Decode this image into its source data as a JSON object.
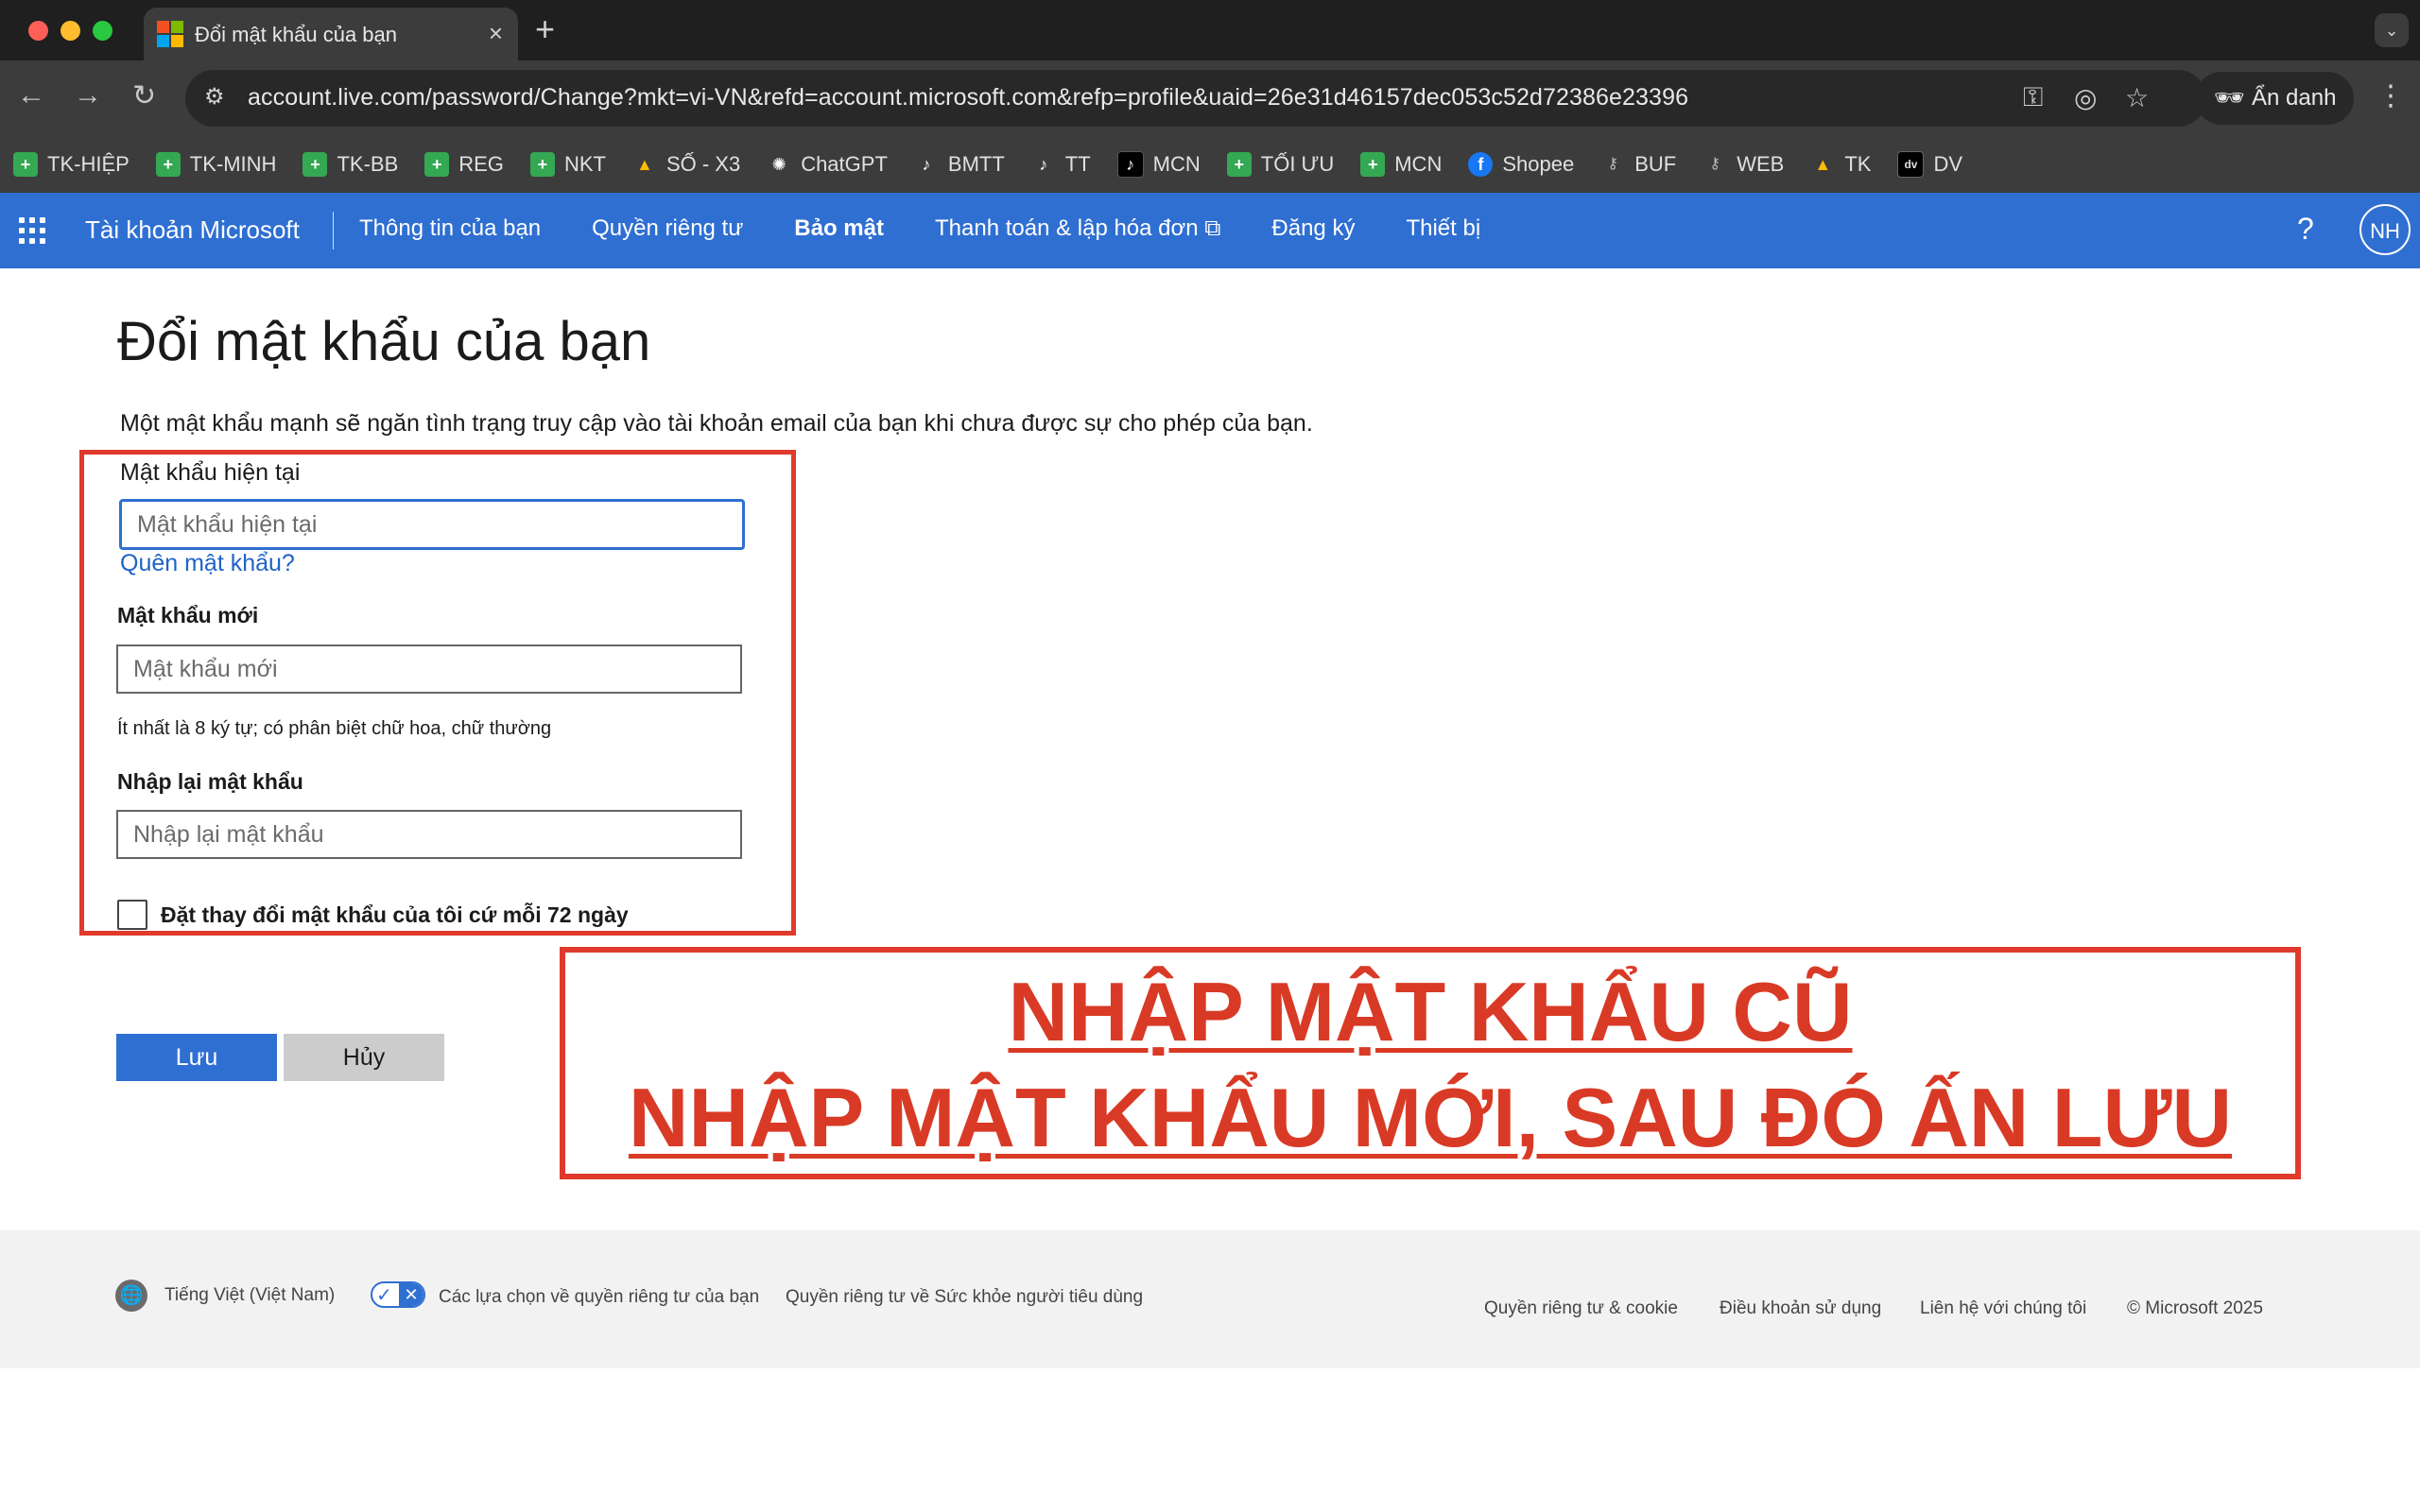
{
  "browser": {
    "tab_title": "Đổi mật khẩu của bạn",
    "tab_close": "×",
    "new_tab": "+",
    "url": "account.live.com/password/Change?mkt=vi-VN&refd=account.microsoft.com&refp=profile&uaid=26e31d46157dec053c52d72386e23396",
    "incognito_label": "Ẩn danh",
    "bookmarks": [
      {
        "label": "TK-HIỆP",
        "icon": "sheets-icon"
      },
      {
        "label": "TK-MINH",
        "icon": "sheets-icon"
      },
      {
        "label": "TK-BB",
        "icon": "sheets-icon"
      },
      {
        "label": "REG",
        "icon": "sheets-icon"
      },
      {
        "label": "NKT",
        "icon": "sheets-icon"
      },
      {
        "label": "SỐ - X3",
        "icon": "drive-icon"
      },
      {
        "label": "ChatGPT",
        "icon": "chatgpt-icon"
      },
      {
        "label": "BMTT",
        "icon": "tiktok-icon"
      },
      {
        "label": "TT",
        "icon": "tiktok-icon"
      },
      {
        "label": "MCN",
        "icon": "tiktok-box-icon"
      },
      {
        "label": "TỐI ƯU",
        "icon": "sheets-icon"
      },
      {
        "label": "MCN",
        "icon": "sheets-icon"
      },
      {
        "label": "Shopee",
        "icon": "facebook-icon"
      },
      {
        "label": "BUF",
        "icon": "key-icon"
      },
      {
        "label": "WEB",
        "icon": "key-icon"
      },
      {
        "label": "TK",
        "icon": "drive-icon"
      },
      {
        "label": "DV",
        "icon": "dv-icon"
      }
    ]
  },
  "ms_header": {
    "brand": "Tài khoản Microsoft",
    "nav": [
      {
        "label": "Thông tin của bạn",
        "active": false
      },
      {
        "label": "Quyền riêng tư",
        "active": false
      },
      {
        "label": "Bảo mật",
        "active": true
      },
      {
        "label": "Thanh toán & lập hóa đơn ⧉",
        "active": false
      },
      {
        "label": "Đăng ký",
        "active": false
      },
      {
        "label": "Thiết bị",
        "active": false
      }
    ],
    "help": "?",
    "avatar_initials": "NH"
  },
  "main": {
    "title": "Đổi mật khẩu của bạn",
    "intro": "Một mật khẩu mạnh sẽ ngăn tình trạng truy cập vào tài khoản email của bạn khi chưa được sự cho phép của bạn.",
    "current_label": "Mật khẩu hiện tại",
    "current_placeholder": "Mật khẩu hiện tại",
    "forgot_link": "Quên mật khẩu?",
    "new_label": "Mật khẩu mới",
    "new_placeholder": "Mật khẩu mới",
    "new_hint": "Ít nhất là 8 ký tự; có phân biệt chữ hoa, chữ thường",
    "confirm_label": "Nhập lại mật khẩu",
    "confirm_placeholder": "Nhập lại mật khẩu",
    "expire_checkbox_label": "Đặt thay đổi mật khẩu của tôi cứ mỗi 72 ngày",
    "expire_checked": false,
    "save_button": "Lưu",
    "cancel_button": "Hủy"
  },
  "annotation": {
    "line1": "NHẬP MẬT KHẨU CŨ",
    "line2": "NHẬP MẬT KHẨU MỚI, SAU ĐÓ ẤN LƯU",
    "color": "#d93a26"
  },
  "footer": {
    "language": "Tiếng Việt (Việt Nam)",
    "privacy_choices": "Các lựa chọn về quyền riêng tư của bạn",
    "consumer_health": "Quyền riêng tư về Sức khỏe người tiêu dùng",
    "privacy_cookies": "Quyền riêng tư & cookie",
    "terms": "Điều khoản sử dụng",
    "contact": "Liên hệ với chúng tôi",
    "copyright": "© Microsoft 2025"
  },
  "colors": {
    "ms_blue": "#2f6fd1",
    "highlight_red": "#e03a2c"
  }
}
